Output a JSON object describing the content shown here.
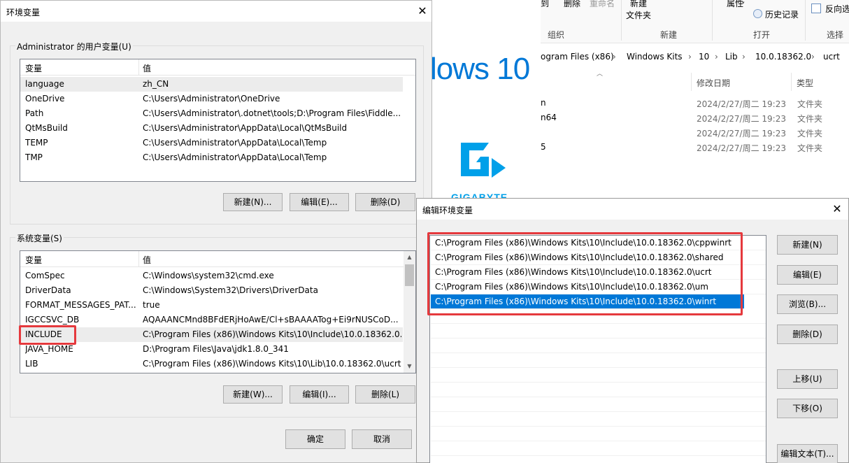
{
  "explorer": {
    "ribbon": {
      "top_items": [
        "到",
        "删除",
        "重命名",
        "新建",
        "文件夹",
        "属性",
        "历史记录",
        "反向选"
      ],
      "groups": [
        "组织",
        "新建",
        "打开",
        "选择"
      ]
    },
    "address": [
      "ogram Files (x86)",
      "Windows Kits",
      "10",
      "Lib",
      "10.0.18362.0",
      "ucrt"
    ],
    "columns": {
      "date": "修改日期",
      "type": "类型"
    },
    "files": [
      {
        "name": "n",
        "date": "2024/2/27/周二 19:23",
        "type": "文件夹"
      },
      {
        "name": "n64",
        "date": "2024/2/27/周二 19:23",
        "type": "文件夹"
      },
      {
        "name": "",
        "date": "2024/2/27/周二 19:23",
        "type": "文件夹"
      },
      {
        "name": "5",
        "date": "2024/2/27/周二 19:23",
        "type": "文件夹"
      }
    ],
    "brand_text": "lows 10",
    "gigabyte_text": "GIGABYTE"
  },
  "env_dialog": {
    "title": "环境变量",
    "user_group_label": "Administrator 的用户变量(U)",
    "col_var": "变量",
    "col_val": "值",
    "user_vars": [
      {
        "name": "language",
        "value": "zh_CN"
      },
      {
        "name": "OneDrive",
        "value": "C:\\Users\\Administrator\\OneDrive"
      },
      {
        "name": "Path",
        "value": "C:\\Users\\Administrator\\.dotnet\\tools;D:\\Program Files\\Fiddle..."
      },
      {
        "name": "QtMsBuild",
        "value": "C:\\Users\\Administrator\\AppData\\Local\\QtMsBuild"
      },
      {
        "name": "TEMP",
        "value": "C:\\Users\\Administrator\\AppData\\Local\\Temp"
      },
      {
        "name": "TMP",
        "value": "C:\\Users\\Administrator\\AppData\\Local\\Temp"
      }
    ],
    "user_buttons": {
      "new": "新建(N)...",
      "edit": "编辑(E)...",
      "delete": "删除(D)"
    },
    "sys_group_label": "系统变量(S)",
    "sys_vars": [
      {
        "name": "ComSpec",
        "value": "C:\\Windows\\system32\\cmd.exe"
      },
      {
        "name": "DriverData",
        "value": "C:\\Windows\\System32\\Drivers\\DriverData"
      },
      {
        "name": "FORMAT_MESSAGES_PAT...",
        "value": "true"
      },
      {
        "name": "IGCCSVC_DB",
        "value": "AQAAANCMnd8BFdERjHoAwE/Cl+sBAAAATog+Ei9rNUSCoD..."
      },
      {
        "name": "INCLUDE",
        "value": "C:\\Program Files (x86)\\Windows Kits\\10\\Include\\10.0.18362.0..."
      },
      {
        "name": "JAVA_HOME",
        "value": "D:\\Program Files\\Java\\jdk1.8.0_341"
      },
      {
        "name": "LIB",
        "value": "C:\\Program Files (x86)\\Windows Kits\\10\\Lib\\10.0.18362.0\\ucrt..."
      }
    ],
    "sys_buttons": {
      "new": "新建(W)...",
      "edit": "编辑(I)...",
      "delete": "删除(L)"
    },
    "ok": "确定",
    "cancel": "取消"
  },
  "edit_dialog": {
    "title": "编辑环境变量",
    "paths": [
      "C:\\Program Files (x86)\\Windows Kits\\10\\Include\\10.0.18362.0\\cppwinrt",
      "C:\\Program Files (x86)\\Windows Kits\\10\\Include\\10.0.18362.0\\shared",
      "C:\\Program Files (x86)\\Windows Kits\\10\\Include\\10.0.18362.0\\ucrt",
      "C:\\Program Files (x86)\\Windows Kits\\10\\Include\\10.0.18362.0\\um",
      "C:\\Program Files (x86)\\Windows Kits\\10\\Include\\10.0.18362.0\\winrt"
    ],
    "buttons": {
      "new": "新建(N)",
      "edit": "编辑(E)",
      "browse": "浏览(B)...",
      "delete": "删除(D)",
      "up": "上移(U)",
      "down": "下移(O)",
      "edit_text": "编辑文本(T)..."
    }
  },
  "colors": {
    "accent": "#0078d7",
    "highlight_box": "#e5393d",
    "dialog_bg": "#f0f0f0"
  }
}
